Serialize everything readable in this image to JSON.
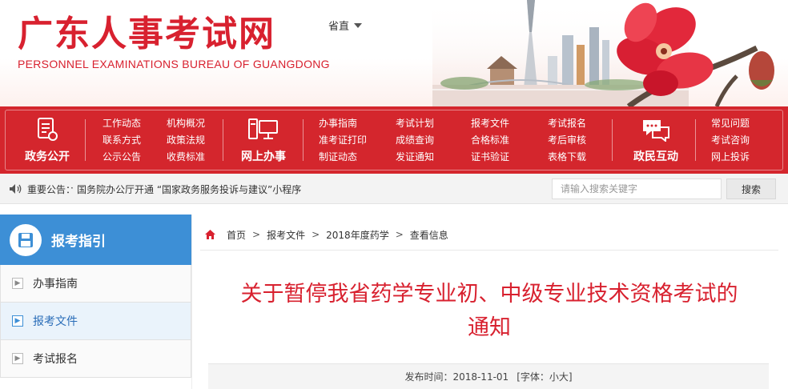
{
  "header": {
    "title": "广东人事考试网",
    "subtitle": "PERSONNEL EXAMINATIONS BUREAU OF GUANGDONG",
    "region_label": "省直"
  },
  "nav": {
    "blocks": [
      {
        "label": "政务公开",
        "icon": "document-icon"
      },
      {
        "label": "网上办事",
        "icon": "computer-icon"
      },
      {
        "label": "政民互动",
        "icon": "chat-icon"
      }
    ],
    "columns": [
      [
        "工作动态",
        "联系方式",
        "公示公告"
      ],
      [
        "机构概况",
        "政策法规",
        "收费标准"
      ],
      [
        "办事指南",
        "准考证打印",
        "制证动态"
      ],
      [
        "考试计划",
        "成绩查询",
        "发证通知"
      ],
      [
        "报考文件",
        "合格标准",
        "证书验证"
      ],
      [
        "考试报名",
        "考后审核",
        "表格下载"
      ],
      [
        "常见问题",
        "考试咨询",
        "网上投诉"
      ]
    ]
  },
  "notice": {
    "label": "重要公告：",
    "bullet": "·",
    "text": "国务院办公厅开通 “国家政务服务投诉与建议”小程序",
    "search_placeholder": "请输入搜索关键字",
    "search_button": "搜索"
  },
  "sidebar": {
    "title": "报考指引",
    "items": [
      {
        "label": "办事指南",
        "active": false
      },
      {
        "label": "报考文件",
        "active": true
      },
      {
        "label": "考试报名",
        "active": false
      }
    ]
  },
  "breadcrumb": {
    "home": "首页",
    "sep": ">",
    "items": [
      "报考文件",
      "2018年度药学",
      "查看信息"
    ]
  },
  "article": {
    "title_line1": "关于暂停我省药学专业初、中级专业技术资格考试的",
    "title_line2": "通知",
    "meta": {
      "publish_label": "发布时间：2018-11-01",
      "font_label": "[字体：小大]"
    }
  },
  "colors": {
    "brand_red": "#d8212f",
    "nav_red": "#d4262d",
    "sidebar_blue": "#3d8fd6"
  }
}
